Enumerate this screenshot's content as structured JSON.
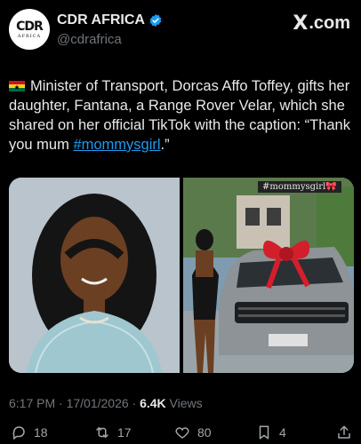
{
  "header": {
    "avatar_logo_main": "CDR",
    "avatar_logo_sub": "AFRICA",
    "display_name": "CDR AFRICA",
    "handle": "@cdrafrica",
    "site": ".com",
    "site_mark": "X"
  },
  "tweet": {
    "text_main": "Minister of Transport, Dorcas Affo Toffey, gifts her daughter, Fantana, a Range Rover Velar, which she shared on her official TikTok with the caption: “Thank you mum ",
    "hashtag": "#mommysgirl",
    "text_end": ".”"
  },
  "media": {
    "caption_overlay": "#mommysgirl🎀"
  },
  "meta": {
    "time": "6:17 PM · 17/01/2026 · ",
    "views_count": "6.4K",
    "views_label": " Views"
  },
  "actions": {
    "replies": "18",
    "reposts": "17",
    "likes": "80",
    "bookmarks": "4"
  },
  "colors": {
    "background": "#000000",
    "text": "#e7e9ea",
    "muted": "#71767b",
    "link": "#1d9bf0",
    "verified": "#1d9bf0"
  }
}
